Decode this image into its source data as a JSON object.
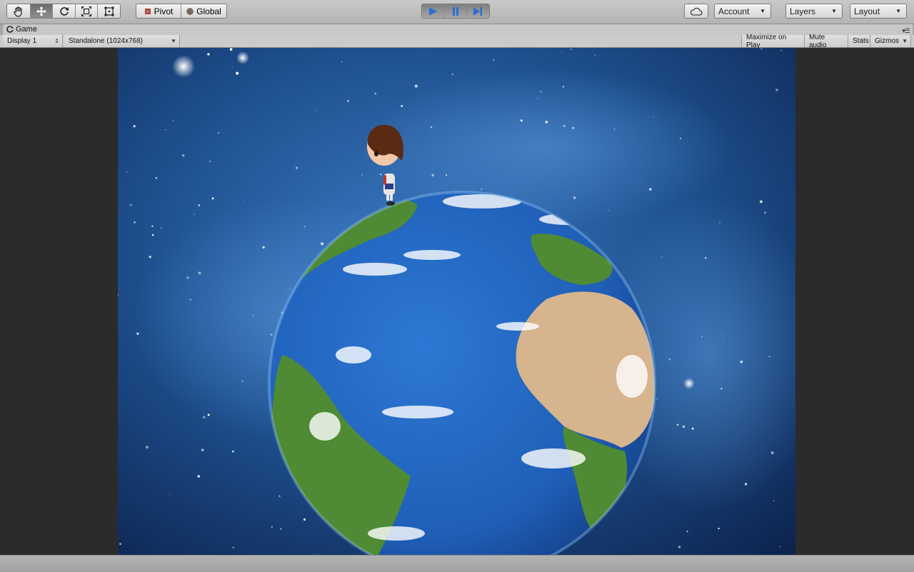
{
  "toolbar": {
    "tools": [
      {
        "name": "hand-tool-icon"
      },
      {
        "name": "move-tool-icon"
      },
      {
        "name": "rotate-tool-icon"
      },
      {
        "name": "scale-tool-icon"
      },
      {
        "name": "rect-tool-icon"
      }
    ],
    "pivot_label": "Pivot",
    "global_label": "Global",
    "account_label": "Account",
    "layers_label": "Layers",
    "layout_label": "Layout",
    "play_color": "#2f6fd6"
  },
  "game_view": {
    "tab_title": "Game",
    "display_label": "Display 1",
    "resolution_label": "Standalone (1024x768)",
    "maximize_on_play_label": "Maximize on Play",
    "mute_audio_label": "Mute audio",
    "stats_label": "Stats",
    "gizmos_label": "Gizmos"
  },
  "scene": {
    "background_colors": [
      "#0b1e46",
      "#1d4e8c",
      "#3a78bf"
    ],
    "ocean_color": "#1f5fb8",
    "land_color": "#4f8a35",
    "desert_color": "#d6b48e",
    "character_hair_color": "#5a2a12"
  }
}
